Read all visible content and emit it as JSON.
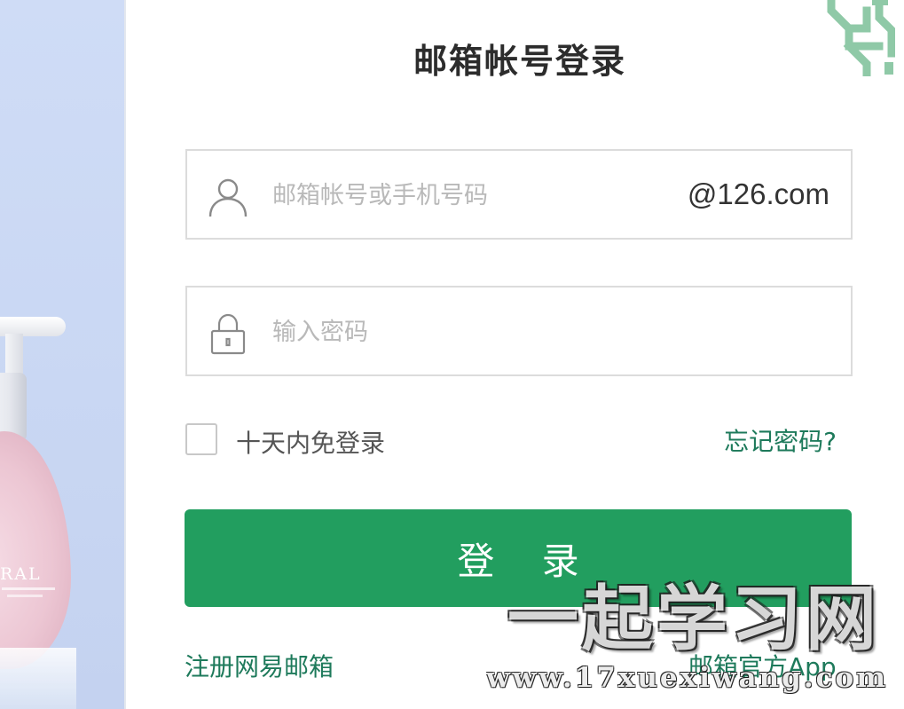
{
  "promo": {
    "brand_text": "RAL"
  },
  "login": {
    "title": "邮箱帐号登录",
    "account": {
      "value": "",
      "placeholder": "邮箱帐号或手机号码",
      "domain_suffix": "@126.com",
      "icon": "user-icon"
    },
    "password": {
      "value": "",
      "placeholder": "输入密码",
      "icon": "lock-icon"
    },
    "remember_label": "十天内免登录",
    "remember_checked": false,
    "forgot_label": "忘记密码?",
    "submit_label": "登 录",
    "register_label": "注册网易邮箱",
    "app_label": "邮箱官方App"
  },
  "watermark": {
    "logo_text": "一起学习网",
    "url": "www.17xuexiwang.com"
  },
  "colors": {
    "accent": "#229e5f",
    "link": "#1e7a5b",
    "title": "#2c2c2c",
    "placeholder": "#b9b9b9",
    "border": "#dcdcdc",
    "ornament": "#8fc9a7"
  }
}
